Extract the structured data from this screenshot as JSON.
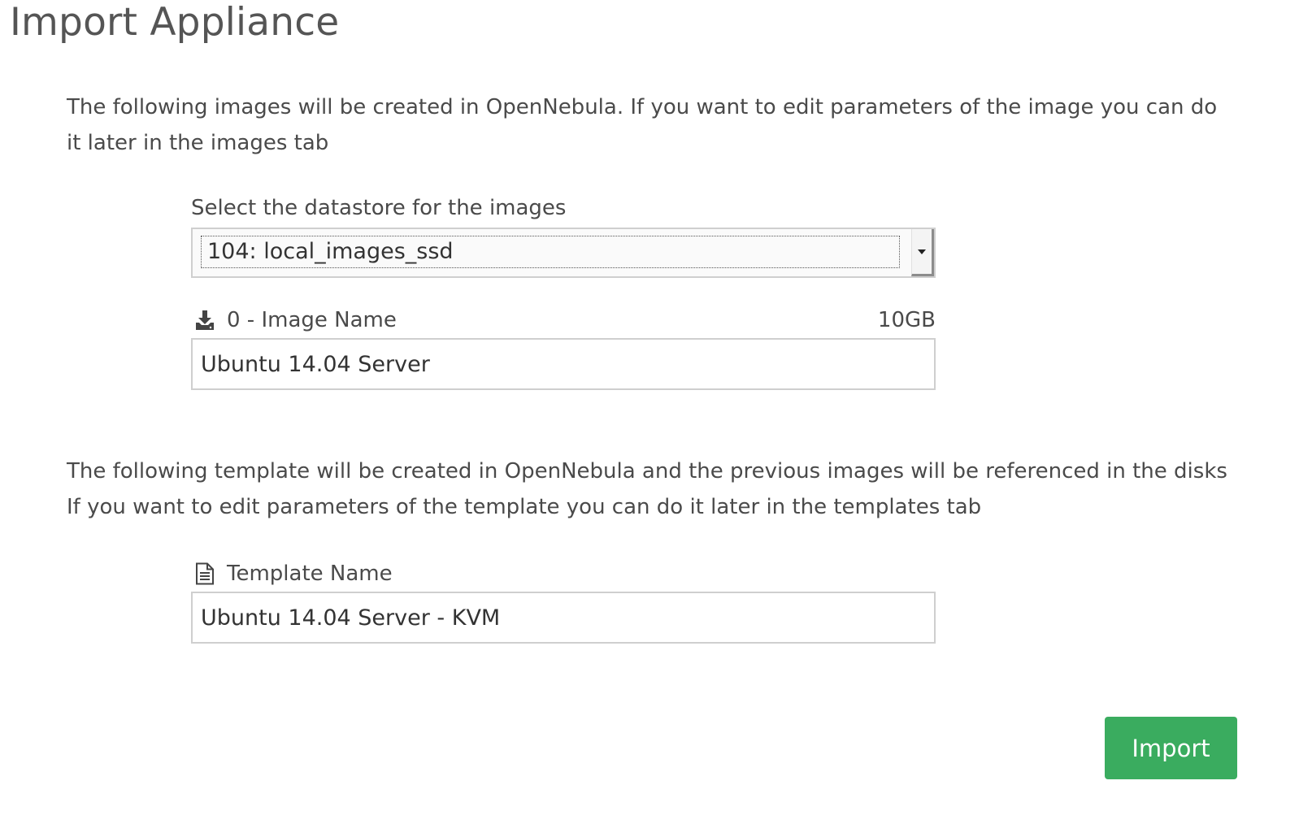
{
  "dialog": {
    "title": "Import Appliance"
  },
  "images_section": {
    "description": "The following images will be created in OpenNebula. If you want to edit parameters of the image you can do it later in the images tab",
    "datastore_label": "Select the datastore for the images",
    "datastore_selected": "104: local_images_ssd",
    "image": {
      "icon": "download-icon",
      "label": "0 - Image Name",
      "size": "10GB",
      "value": "Ubuntu 14.04 Server"
    }
  },
  "template_section": {
    "description_line1": "The following template will be created in OpenNebula and the previous images will be referenced in the disks",
    "description_line2": "If you want to edit parameters of the template you can do it later in the templates tab",
    "icon": "document-icon",
    "label": "Template Name",
    "value": "Ubuntu 14.04 Server - KVM"
  },
  "actions": {
    "import_label": "Import",
    "import_color": "#3aac5f"
  }
}
